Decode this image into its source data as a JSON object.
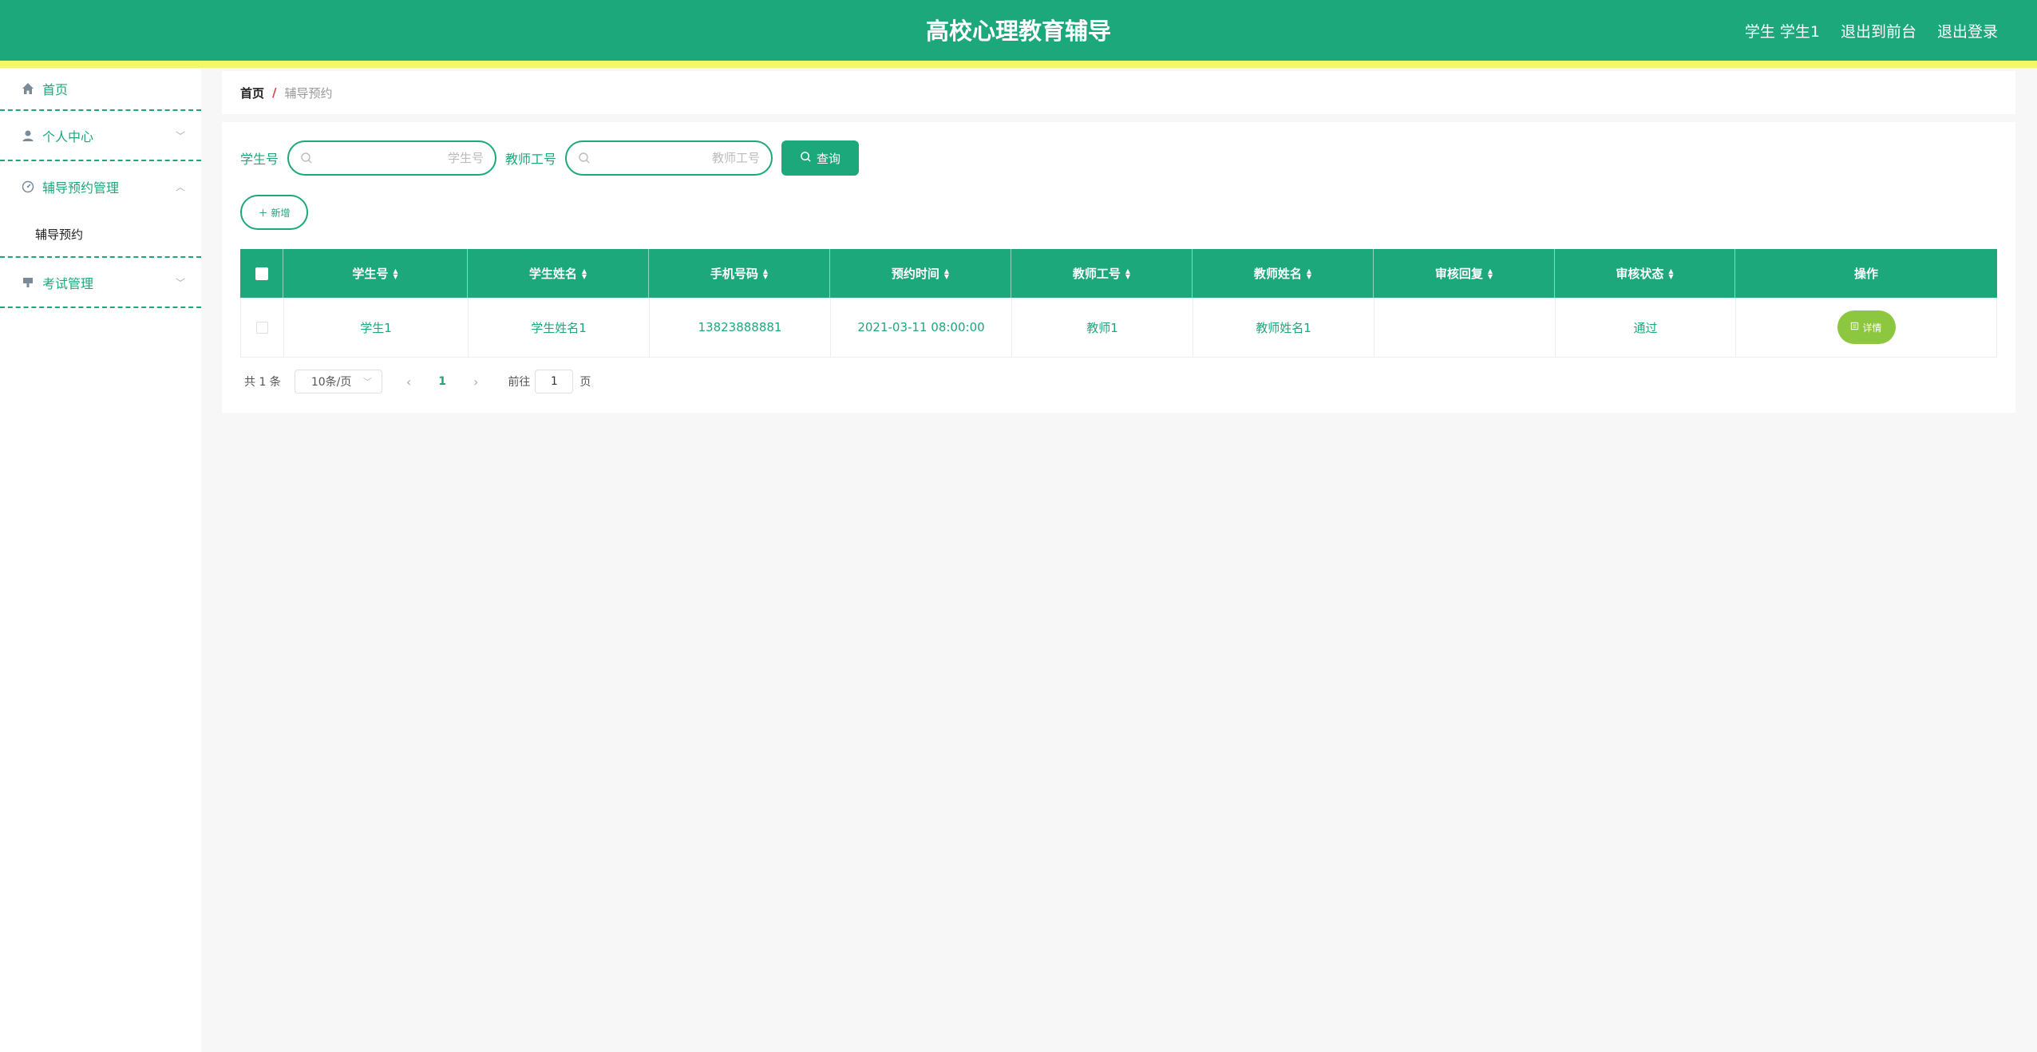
{
  "header": {
    "title": "高校心理教育辅导",
    "user": "学生 学生1",
    "back_to_front": "退出到前台",
    "logout": "退出登录"
  },
  "sidebar": {
    "items": [
      {
        "label": "首页",
        "icon": "home-icon"
      },
      {
        "label": "个人中心",
        "icon": "user-icon"
      },
      {
        "label": "辅导预约管理",
        "icon": "gauge-icon",
        "expanded": true,
        "children": [
          {
            "label": "辅导预约"
          }
        ]
      },
      {
        "label": "考试管理",
        "icon": "exam-icon"
      }
    ]
  },
  "breadcrumb": {
    "home": "首页",
    "separator": "/",
    "current": "辅导预约"
  },
  "search": {
    "student_no_label": "学生号",
    "student_no_placeholder": "学生号",
    "teacher_no_label": "教师工号",
    "teacher_no_placeholder": "教师工号",
    "query_label": "查询"
  },
  "actions": {
    "add_label": "新增"
  },
  "table": {
    "columns": [
      "学生号",
      "学生姓名",
      "手机号码",
      "预约时间",
      "教师工号",
      "教师姓名",
      "审核回复",
      "审核状态",
      "操作"
    ],
    "rows": [
      {
        "student_no": "学生1",
        "student_name": "学生姓名1",
        "phone": "13823888881",
        "appointment_time": "2021-03-11 08:00:00",
        "teacher_no": "教师1",
        "teacher_name": "教师姓名1",
        "review_reply": "",
        "review_status": "通过",
        "detail_label": "详情"
      }
    ]
  },
  "pagination": {
    "total_text": "共 1 条",
    "page_size": "10条/页",
    "current_page": "1",
    "goto_prefix": "前往",
    "goto_value": "1",
    "goto_suffix": "页"
  },
  "colors": {
    "primary": "#1ca87b",
    "stripe": "#f5f76a",
    "detail": "#8dc63f"
  }
}
